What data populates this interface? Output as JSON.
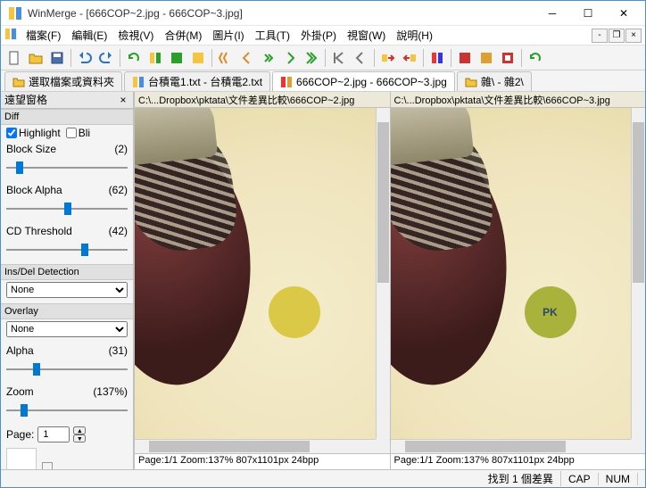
{
  "window": {
    "app": "WinMerge",
    "doc": "[666COP~2.jpg - 666COP~3.jpg]"
  },
  "menu": {
    "file": "檔案(F)",
    "edit": "編輯(E)",
    "view": "檢視(V)",
    "merge": "合併(M)",
    "image": "圖片(I)",
    "tools": "工具(T)",
    "plugins": "外掛(P)",
    "window": "視窗(W)",
    "help": "說明(H)"
  },
  "tabs": {
    "select": "選取檔案或資料夾",
    "t1": "台積電1.txt - 台積電2.txt",
    "t2": "666COP~2.jpg - 666COP~3.jpg",
    "t3": "雜\\ - 雜2\\"
  },
  "sidebar": {
    "title": "遠望窗格",
    "diff": "Diff",
    "highlight": "Highlight",
    "blink": "Bli",
    "block_size": "Block Size",
    "block_size_v": "(2)",
    "block_alpha": "Block Alpha",
    "block_alpha_v": "(62)",
    "cd_thresh": "CD Threshold",
    "cd_thresh_v": "(42)",
    "insdel": "Ins/Del Detection",
    "none": "None",
    "overlay": "Overlay",
    "alpha": "Alpha",
    "alpha_v": "(31)",
    "zoom": "Zoom",
    "zoom_v": "(137%)",
    "page": "Page:",
    "page_v": "1"
  },
  "panes": {
    "left_path": "C:\\...Dropbox\\pktata\\文件差異比較\\666COP~2.jpg",
    "right_path": "C:\\...Dropbox\\pktata\\文件差異比較\\666COP~3.jpg",
    "left_info": "Page:1/1 Zoom:137% 807x1101px 24bpp",
    "right_info": "Page:1/1 Zoom:137% 807x1101px 24bpp",
    "pk": "PK"
  },
  "status": {
    "diff": "找到 1 個差異",
    "cap": "CAP",
    "num": "NUM"
  },
  "slider_pos": {
    "block_size": "8%",
    "block_alpha": "48%",
    "cd_thresh": "62%",
    "alpha": "22%",
    "zoom": "12%"
  }
}
